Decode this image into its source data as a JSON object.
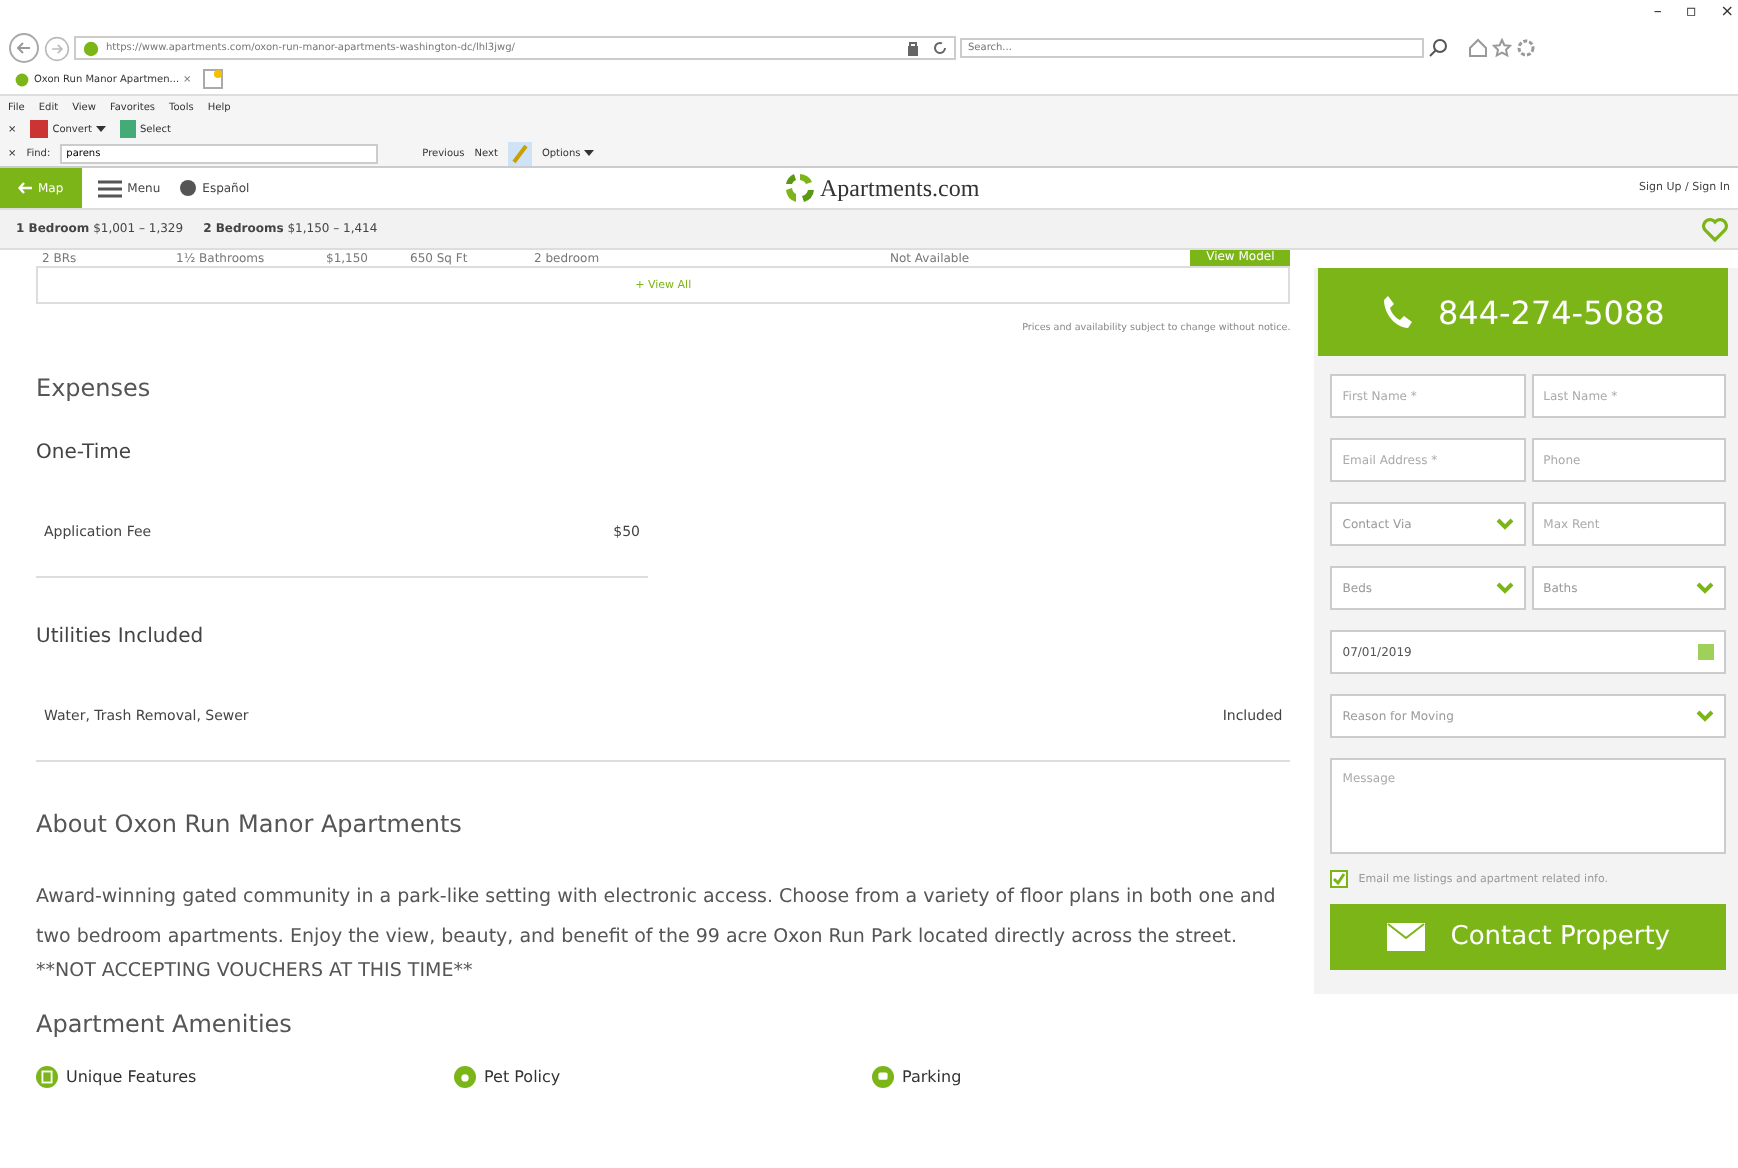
{
  "window_controls": [
    "–",
    "▫",
    "×"
  ],
  "browser": {
    "url": "https://www.apartments.com/oxon-run-manor-apartments-washington-dc/lhl3jwg/",
    "search_placeholder": "Search...",
    "tab": "Oxon Run Manor Apartmen...",
    "tab_close": "×",
    "menu": [
      "File",
      "Edit",
      "View",
      "Favorites",
      "Tools",
      "Help"
    ],
    "command_bar": {
      "close": "×",
      "convert": "Convert",
      "select": "Select"
    },
    "find_bar": {
      "close": "×",
      "label": "Find:",
      "value": "parens",
      "previous": "Previous",
      "next": "Next",
      "options": "Options"
    }
  },
  "header": {
    "map": "Map",
    "menu": "Menu",
    "language": "Español",
    "logo": "Apartments.com",
    "sign_in": "Sign Up / Sign In"
  },
  "price_bar": [
    {
      "beds": "1 Bedroom",
      "range": "$1,001 – 1,329"
    },
    {
      "beds": "2 Bedrooms",
      "range": "$1,150 – 1,414"
    }
  ],
  "floorplan_row": {
    "cells": [
      "2 BRs",
      "1½ Bathrooms",
      "$1,150",
      "650 Sq Ft",
      "2 bedroom",
      "Not Available"
    ],
    "button": "View Model"
  },
  "view_all": "+ View All",
  "price_note": "Prices and availability subject to change without notice.",
  "expenses": {
    "title": "Expenses",
    "sections": [
      {
        "title": "One-Time",
        "rows": [
          {
            "label": "Application Fee",
            "value": "$50"
          }
        ],
        "wide": false
      },
      {
        "title": "Utilities Included",
        "rows": [
          {
            "label": "Water, Trash Removal, Sewer",
            "value": "Included"
          }
        ],
        "wide": true
      }
    ]
  },
  "about": {
    "title": "About Oxon Run Manor Apartments",
    "text": "Award-winning gated community in a park-like setting with electronic access. Choose from a variety of floor plans in both one and two bedroom apartments. Enjoy the view, beauty, and benefit of the 99 acre Oxon Run Park located directly across the street.",
    "notice": "**NOT ACCEPTING VOUCHERS AT THIS TIME**"
  },
  "amenities": {
    "title": "Apartment Amenities",
    "items": [
      {
        "label": "Unique Features",
        "kind": "features"
      },
      {
        "label": "Pet Policy",
        "kind": "pet"
      },
      {
        "label": "Parking",
        "kind": "parking"
      }
    ]
  },
  "contact": {
    "phone": "844-274-5088",
    "fields": [
      [
        {
          "placeholder": "First Name *",
          "kind": "text"
        },
        {
          "placeholder": "Last Name *",
          "kind": "text"
        }
      ],
      [
        {
          "placeholder": "Email Address *",
          "kind": "text"
        },
        {
          "placeholder": "Phone",
          "kind": "text"
        }
      ],
      [
        {
          "placeholder": "Contact Via",
          "kind": "select"
        },
        {
          "placeholder": "Max Rent",
          "kind": "text"
        }
      ],
      [
        {
          "placeholder": "Beds",
          "kind": "select"
        },
        {
          "placeholder": "Baths",
          "kind": "select"
        }
      ],
      [
        {
          "value": "07/01/2019",
          "kind": "date"
        }
      ],
      [
        {
          "placeholder": "Reason for Moving",
          "kind": "select"
        }
      ],
      [
        {
          "placeholder": "Message",
          "kind": "textarea"
        }
      ]
    ],
    "opt_in": {
      "label": "Email me listings and apartment related info.",
      "checked": true
    },
    "button": "Contact Property"
  }
}
